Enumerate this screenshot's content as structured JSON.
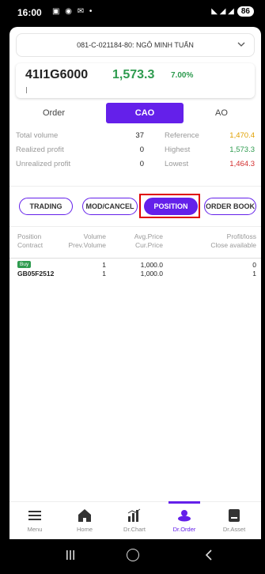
{
  "status_bar": {
    "time": "16:00",
    "icons": "▣ ◉ ✉ •",
    "signal": "◣ ◢ ◢",
    "battery": "86"
  },
  "account": {
    "text": "081-C-021184-80: NGÔ MINH TUẤN"
  },
  "ticker": {
    "symbol": "41I1G6000",
    "price": "1,573.3",
    "change_pct": "7.00%"
  },
  "order_tabs": [
    {
      "label": "Order",
      "active": false
    },
    {
      "label": "CAO",
      "active": true
    },
    {
      "label": "AO",
      "active": false
    }
  ],
  "stats": {
    "rows": [
      {
        "label1": "Total volume",
        "value1": "37",
        "label2": "Reference",
        "value2": "1,470.4",
        "color2": "#e0a000"
      },
      {
        "label1": "Realized profit",
        "value1": "0",
        "label2": "Highest",
        "value2": "1,573.3",
        "color2": "#2e9b4f"
      },
      {
        "label1": "Unrealized profit",
        "value1": "0",
        "label2": "Lowest",
        "value2": "1,464.3",
        "color2": "#d32f2f"
      }
    ]
  },
  "action_buttons": [
    {
      "label": "TRADING",
      "active": false
    },
    {
      "label": "MOD/CANCEL",
      "active": false
    },
    {
      "label": "POSITION",
      "active": true
    },
    {
      "label": "ORDER BOOK",
      "active": false
    }
  ],
  "table": {
    "headers": {
      "position": "Position",
      "contract": "Contract",
      "volume": "Volume",
      "prev_volume": "Prev.Volume",
      "avg_price": "Avg.Price",
      "cur_price": "Cur.Price",
      "profit_loss": "Profit/loss",
      "close_available": "Close available"
    },
    "rows": [
      {
        "side": "Buy",
        "contract": "GB05F2512",
        "volume": "1",
        "prev_volume": "1",
        "avg_price": "1,000.0",
        "cur_price": "1,000.0",
        "profit_loss": "0",
        "close_available": "1"
      }
    ]
  },
  "bottom_nav": [
    {
      "label": "Menu",
      "icon": "menu-icon",
      "active": false
    },
    {
      "label": "Home",
      "icon": "home-icon",
      "active": false
    },
    {
      "label": "Dr.Chart",
      "icon": "chart-icon",
      "active": false
    },
    {
      "label": "Dr.Order",
      "icon": "order-icon",
      "active": true
    },
    {
      "label": "Dr.Asset",
      "icon": "asset-icon",
      "active": false
    }
  ],
  "colors": {
    "accent": "#6420ea",
    "up": "#2e9b4f",
    "down": "#d32f2f",
    "reference": "#e0a000"
  }
}
